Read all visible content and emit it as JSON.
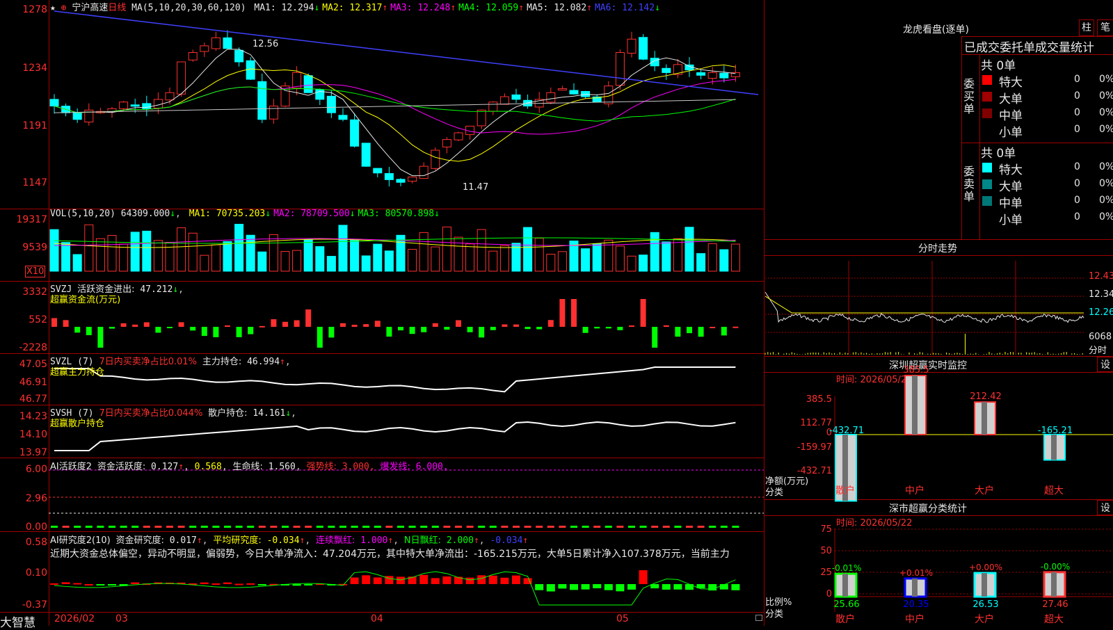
{
  "stock": {
    "star": "★",
    "ctrl": "⊕",
    "name": "宁沪高速",
    "period": "日线",
    "ma_header": "MA(5,10,20,30,60,120)",
    "ma": [
      {
        "label": "MA1:",
        "value": "12.294",
        "arrow": "↓",
        "color": "#e8e8e8"
      },
      {
        "label": "MA2:",
        "value": "12.317",
        "arrow": "↑",
        "color": "#ffff00"
      },
      {
        "label": "MA3:",
        "value": "12.248",
        "arrow": "↑",
        "color": "#ff00ff"
      },
      {
        "label": "MA4:",
        "value": "12.059",
        "arrow": "↑",
        "color": "#00ff00"
      },
      {
        "label": "MA5:",
        "value": "12.082",
        "arrow": "↑",
        "color": "#e8e8e8"
      },
      {
        "label": "MA6:",
        "value": "12.142",
        "arrow": "↓",
        "color": "#4040ff"
      }
    ],
    "price_axis": [
      "1278",
      "1234",
      "1191",
      "1147"
    ],
    "high_label": "12.56",
    "low_label": "11.47",
    "colors": {
      "up": "#ff3030",
      "down": "#00ffff",
      "grid": "#a00000"
    }
  },
  "vol": {
    "header": "VOL(5,10,20)",
    "value": "64309.000",
    "arrow": "↓",
    "ma": [
      {
        "label": "MA1:",
        "value": "70735.203",
        "arrow": "↓",
        "color": "#ffff00"
      },
      {
        "label": "MA2:",
        "value": "78709.500",
        "arrow": "↓",
        "color": "#ff00ff"
      },
      {
        "label": "MA3:",
        "value": "80570.898",
        "arrow": "↓",
        "color": "#00ff00"
      }
    ],
    "axis": [
      "19317",
      "9539"
    ],
    "unit": "X10"
  },
  "svzj": {
    "name": "SVZJ",
    "label": "活跃资金进出:",
    "value": "47.212",
    "arrow": "↓",
    "sub": "超赢资金流(万元)",
    "axis": [
      "3332",
      "552",
      "-2228"
    ]
  },
  "svzl": {
    "name": "SVZL (7)",
    "desc": "7日内买卖净占比0.01%",
    "label": "主力持仓:",
    "value": "46.994",
    "arrow": "↑",
    "sub": "超赢主力持仓",
    "axis": [
      "47.05",
      "46.91",
      "46.77"
    ]
  },
  "svsh": {
    "name": "SVSH (7)",
    "desc": "7日内买卖净占比0.044%",
    "label": "散户持仓:",
    "value": "14.161",
    "arrow": "↓",
    "sub": "超赢散户持仓",
    "axis": [
      "14.23",
      "14.10",
      "13.97"
    ]
  },
  "ai_active": {
    "name": "AI活跃度2",
    "label": "资金活跃度:",
    "value": "0.127",
    "v2": "0.568",
    "life_label": "生命线:",
    "life": "1.560",
    "strong_label": "强势线:",
    "strong": "3.000",
    "burst_label": "爆发线:",
    "burst": "6.000",
    "axis": [
      "6.00",
      "2.96",
      "0.00"
    ]
  },
  "ai_research": {
    "name": "AI研究度2(10)",
    "label": "资金研究度:",
    "value": "0.017",
    "avg_label": "平均研究度:",
    "avg": "-0.034",
    "cont_label": "连续飘红:",
    "cont": "1.000",
    "nday_label": "N日飘红:",
    "nday": "2.000",
    "last": "-0.034",
    "summary": "近期大资金总体偏空，异动不明显，偏弱势，今日大单净流入：47.204万元，其中特大单净流出：-165.215万元，大单5日累计净入107.378万元，当前主力",
    "axis": [
      "0.58",
      "0.10",
      "-0.37"
    ]
  },
  "dates": {
    "brand": "大智慧",
    "labels": [
      "2026/02",
      "03",
      "04",
      "05"
    ]
  },
  "dragon": {
    "title": "龙虎看盘(逐单)",
    "btn1": "柱",
    "btn2": "笔",
    "subtitle": "已成交委托单成交量统计",
    "buy_side": "委买单",
    "sell_side": "委卖单",
    "buy_total": "共 0单",
    "sell_total": "共 0单",
    "buy_rows": [
      {
        "name": "特大",
        "count": "0",
        "pct": "0%",
        "color": "#ff0000"
      },
      {
        "name": "大单",
        "count": "0",
        "pct": "0%",
        "color": "#a00000"
      },
      {
        "name": "中单",
        "count": "0",
        "pct": "0%",
        "color": "#800000"
      },
      {
        "name": "小单",
        "count": "0",
        "pct": "0%",
        "color": ""
      }
    ],
    "sell_rows": [
      {
        "name": "特大",
        "count": "0",
        "pct": "0%",
        "color": "#00ffff"
      },
      {
        "name": "大单",
        "count": "0",
        "pct": "0%",
        "color": "#008888"
      },
      {
        "name": "中单",
        "count": "0",
        "pct": "0%",
        "color": "#007777"
      },
      {
        "name": "小单",
        "count": "0",
        "pct": "0%",
        "color": ""
      }
    ]
  },
  "intraday": {
    "title": "分时走势",
    "axis": [
      "12.43",
      "12.34",
      "12.26"
    ],
    "vol": "6068",
    "vol_unit": "分时"
  },
  "monitor": {
    "title": "深圳超赢实时监控",
    "set": "设",
    "time_label": "时间:",
    "time": "2026/05/22",
    "axis": [
      "385.5",
      "112.77",
      "0",
      "-159.97",
      "-432.71"
    ],
    "ylab1": "净额(万元)",
    "ylab2": "分类",
    "bars": [
      {
        "cat": "散户",
        "value": "-432.71",
        "color": "#00ffff"
      },
      {
        "cat": "中户",
        "value": "385.5",
        "color": "#ff3030"
      },
      {
        "cat": "大户",
        "value": "212.42",
        "color": "#ff3030"
      },
      {
        "cat": "超大",
        "value": "-165.21",
        "color": "#00ffff"
      }
    ]
  },
  "classify": {
    "title": "深市超赢分类统计",
    "set": "设",
    "time_label": "时间:",
    "time": "2026/05/22",
    "axis": [
      "75",
      "50",
      "25",
      "0"
    ],
    "ylab1": "比例%",
    "ylab2": "分类",
    "bars": [
      {
        "cat": "散户",
        "pct": "25.66",
        "chg": "-0.01%",
        "color": "#00ff00",
        "chg_color": "#00ff00"
      },
      {
        "cat": "中户",
        "pct": "20.35",
        "chg": "+0.01%",
        "color": "#0000ff",
        "chg_color": "#ff3030"
      },
      {
        "cat": "大户",
        "pct": "26.53",
        "chg": "+0.00%",
        "color": "#00ffff",
        "chg_color": "#ff3030"
      },
      {
        "cat": "超大",
        "pct": "27.46",
        "chg": "-0.00%",
        "color": "#ff3030",
        "chg_color": "#00ff00"
      }
    ]
  }
}
